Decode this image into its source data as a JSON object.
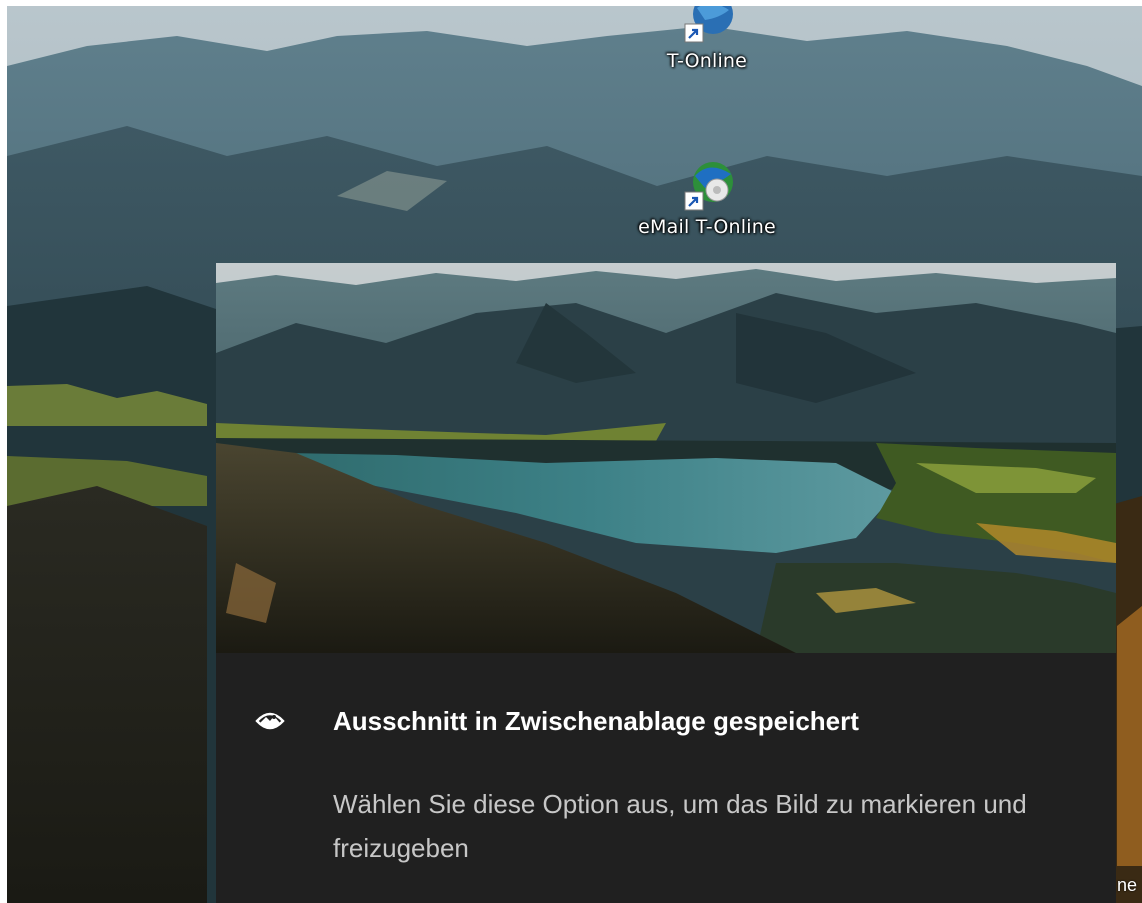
{
  "desktop": {
    "icons": [
      {
        "label": "T-Online",
        "icon": "t-online-globe-icon"
      },
      {
        "label": "eMail T-Online",
        "icon": "email-t-online-globe-icon"
      }
    ],
    "edge_text": "ne"
  },
  "toast": {
    "app_icon": "snip-and-sketch-icon",
    "title": "Ausschnitt in Zwischenablage gespeichert",
    "message": "Wählen Sie diese Option aus, um das Bild zu markieren und freizugeben"
  },
  "colors": {
    "toast_background": "#202020",
    "toast_title": "#ffffff",
    "toast_message": "#c7c7c7"
  }
}
